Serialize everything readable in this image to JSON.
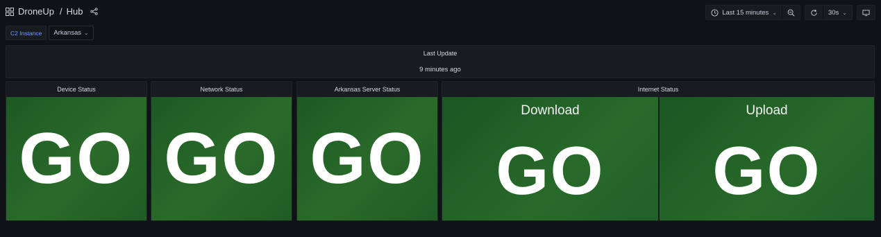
{
  "header": {
    "app_name": "DroneUp",
    "separator": "/",
    "dashboard": "Hub"
  },
  "controls": {
    "time_range": "Last 15 minutes",
    "refresh_interval": "30s"
  },
  "variables": {
    "label": "C2 Instance",
    "value": "Arkansas"
  },
  "panels": {
    "last_update": {
      "title": "Last Update",
      "value": "9 minutes ago"
    },
    "device": {
      "title": "Device Status",
      "value": "GO"
    },
    "network": {
      "title": "Network Status",
      "value": "GO"
    },
    "server": {
      "title": "Arkansas Server Status",
      "value": "GO"
    },
    "internet": {
      "title": "Internet Status",
      "download": {
        "label": "Download",
        "value": "GO"
      },
      "upload": {
        "label": "Upload",
        "value": "GO"
      }
    }
  },
  "colors": {
    "background": "#111217",
    "panel": "#181b1f",
    "status_ok": "#2a6a2a",
    "variable_label": "#6e9fff"
  },
  "icons": {
    "dashboard": "grid-icon",
    "share": "share-icon",
    "time": "clock-icon",
    "zoom": "zoom-out-icon",
    "refresh": "refresh-icon",
    "tv": "tv-mode-icon"
  }
}
